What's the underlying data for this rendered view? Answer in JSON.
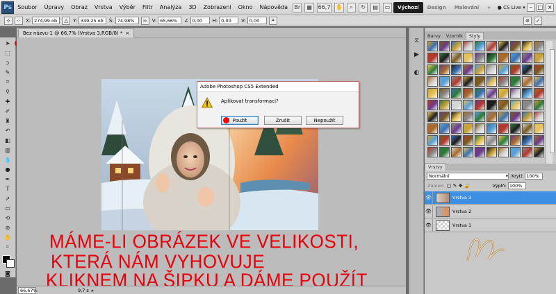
{
  "app": {
    "logo": "Ps"
  },
  "menubar": {
    "items": [
      "Soubor",
      "Úpravy",
      "Obraz",
      "Vrstva",
      "Výběr",
      "Filtr",
      "Analýza",
      "3D",
      "Zobrazení",
      "Okno",
      "Nápověda"
    ],
    "icons": [
      "br-icon",
      "mini-bridge-icon",
      "zoom-level-icon",
      "hand-icon",
      "zoom-icon",
      "rotate-icon",
      "arrange-icon",
      "screen-mode-icon"
    ],
    "zoom_value": "66,7",
    "workspaces": [
      "Výchozí",
      "Design",
      "Malování"
    ],
    "active_workspace": "Výchozí",
    "cs_live": "CS Live"
  },
  "options": {
    "x_label": "X:",
    "x_value": "274,99 ob",
    "y_label": "Y:",
    "y_value": "349,25 ob",
    "w_label": "Š:",
    "w_value": "74,98%",
    "h_label": "V:",
    "h_value": "65,66%",
    "angle_value": "0,00",
    "hskew_label": "H:",
    "hskew_value": "0,00",
    "vskew_label": "V:",
    "vskew_value": "0,00"
  },
  "document": {
    "tab_title": "Bez názvu-1 @ 66,7% (Vrstva 3,RGB/8) *"
  },
  "dialog": {
    "title": "Adobe Photoshop CS5 Extended",
    "message": "Aplikovat transformaci?",
    "apply": "Použít",
    "cancel": "Zrušit",
    "dont_apply": "Nepoužít"
  },
  "annotation": {
    "line1": "MÁME-LI OBRÁZEK VE VELIKOSTI,",
    "line2": "KTERÁ NÁM VYHOVUJE",
    "line3": "KLIKNEM  NA ŠIPKU A DÁME POUŽÍT",
    "color": "#e8000a"
  },
  "statusbar": {
    "zoom": "66,67%",
    "doc_size": "9,7 s"
  },
  "panels": {
    "style_tabs": [
      "Barvy",
      "Vzorník",
      "Styly"
    ],
    "active_style_tab": "Styly",
    "layers_tab": "Vrstvy",
    "blend_mode": "Normální",
    "opacity_label": "Krytí:",
    "opacity_value": "100%",
    "lock_label": "Zámek:",
    "fill_label": "Výplň:",
    "fill_value": "100%",
    "layers": [
      {
        "name": "Vrstva 3",
        "selected": true
      },
      {
        "name": "Vrstva 2",
        "selected": false
      },
      {
        "name": "Vrstva 1",
        "selected": false
      }
    ]
  },
  "colors": {
    "accent_selected_layer": "#3c8fe2",
    "marker_red": "#ff0000"
  }
}
